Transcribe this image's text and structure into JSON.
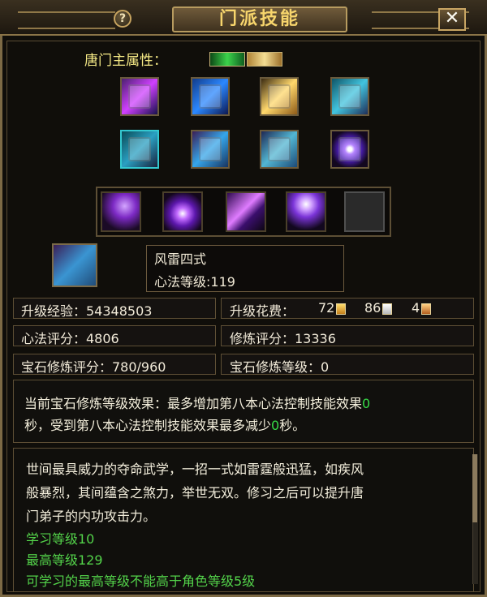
{
  "window": {
    "title": "门派技能",
    "help": "?",
    "close": "✕"
  },
  "attribute": {
    "label": "唐门主属性："
  },
  "selected_skill": {
    "name": "风雷四式",
    "level": "心法等级:119"
  },
  "stats": {
    "upgrade_exp_label": "升级经验：54348503",
    "upgrade_cost_label": "升级花费：",
    "cost_1": "72",
    "cost_2": "86",
    "cost_3": "4",
    "heart_score": "心法评分：4806",
    "train_score": "修炼评分：13336",
    "gem_train_score": "宝石修炼评分：780/960",
    "gem_train_level": "宝石修炼等级：0"
  },
  "effect": {
    "line1_text": "当前宝石修炼等级效果：最多增加第八本心法控制技能效果",
    "line1_value": "0",
    "line2_prefix": "秒，受到第八本心法控制技能效果最多减少",
    "line2_value": "0",
    "line2_suffix": "秒。"
  },
  "description": {
    "line1": "世间最具威力的夺命武学，一招一式如雷霆般迅猛，如疾风",
    "line2": "般暴烈，其间蕴含之煞力，举世无双。修习之后可以提升唐",
    "line3": "门弟子的内功攻击力。",
    "learn_level": "学习等级10",
    "max_level": "最高等级129",
    "limit": "可学习的最高等级不能高于角色等级5级"
  },
  "colors": {
    "title": "#f7d56c",
    "label_yellow": "#f6ea86",
    "text": "#f2ebd9",
    "green": "#37d947"
  },
  "icons": {
    "help": "question-icon",
    "close": "close-icon",
    "exp": "book-icon",
    "cost": "coin-book-icon"
  }
}
